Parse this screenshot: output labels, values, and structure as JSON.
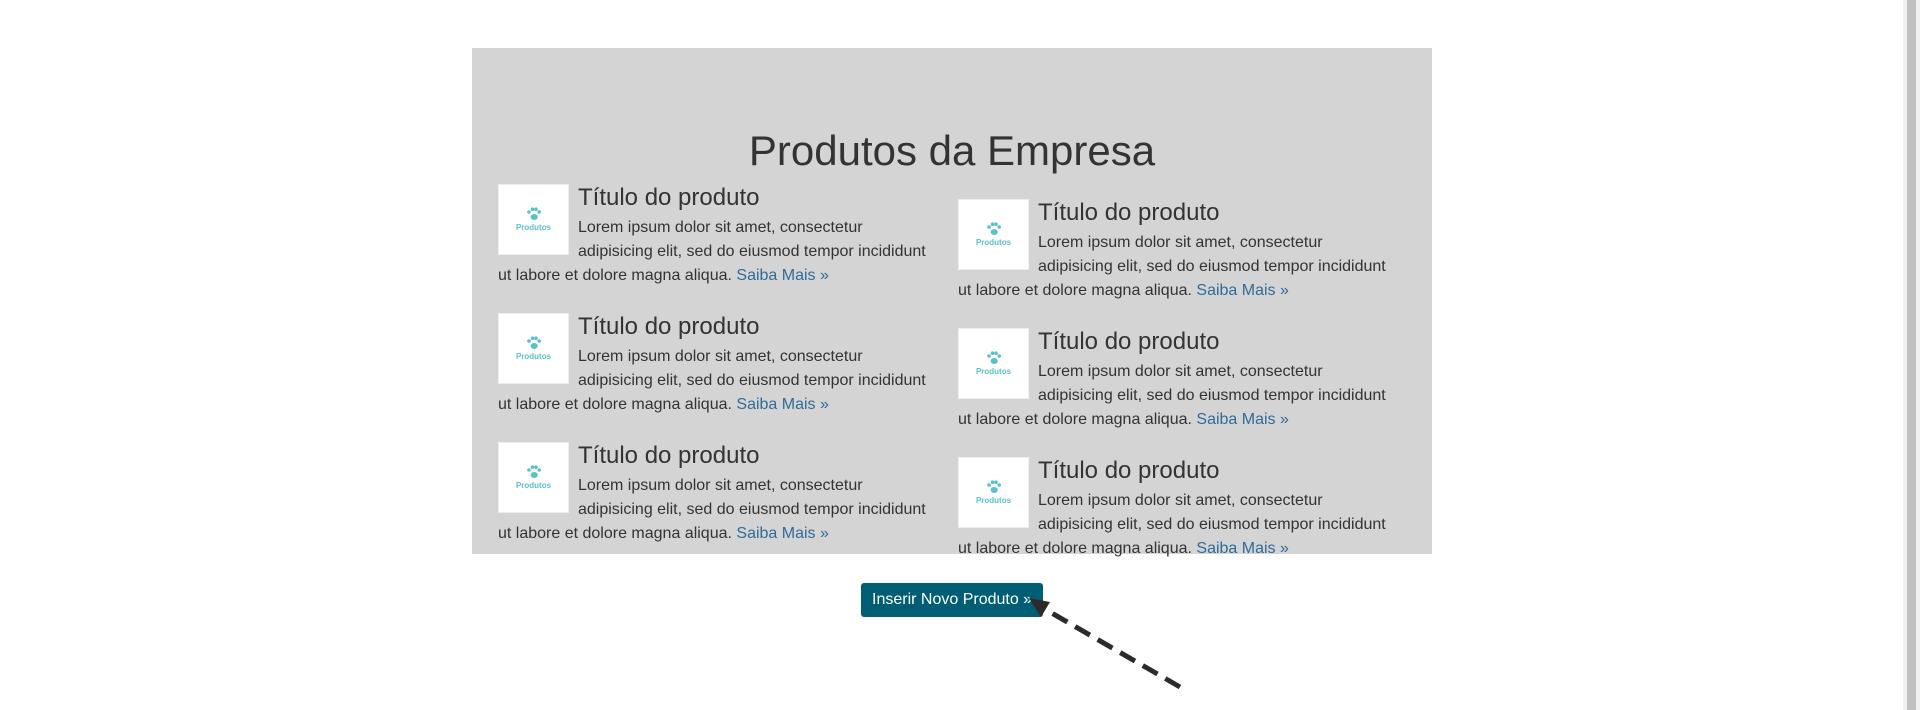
{
  "panel": {
    "title": "Produtos da Empresa"
  },
  "products_left": [
    {
      "title": "Título do produto",
      "description": "Lorem ipsum dolor sit amet, consectetur adipisicing elit, sed do eiusmod tempor incididunt ut labore et dolore magna aliqua.",
      "link": "Saiba Mais »",
      "thumb_text": "Produtos",
      "thumb_icon": "paw-icon"
    },
    {
      "title": "Título do produto",
      "description": "Lorem ipsum dolor sit amet, consectetur adipisicing elit, sed do eiusmod tempor incididunt ut labore et dolore magna aliqua.",
      "link": "Saiba Mais »",
      "thumb_text": "Produtos",
      "thumb_icon": "paw-icon"
    },
    {
      "title": "Título do produto",
      "description": "Lorem ipsum dolor sit amet, consectetur adipisicing elit, sed do eiusmod tempor incididunt ut labore et dolore magna aliqua.",
      "link": "Saiba Mais »",
      "thumb_text": "Produtos",
      "thumb_icon": "paw-icon"
    }
  ],
  "products_right": [
    {
      "title": "Título do produto",
      "description": "Lorem ipsum dolor sit amet, consectetur adipisicing elit, sed do eiusmod tempor incididunt ut labore et dolore magna aliqua.",
      "link": "Saiba Mais »",
      "thumb_text": "Produtos",
      "thumb_icon": "paw-icon"
    },
    {
      "title": "Título do produto",
      "description": "Lorem ipsum dolor sit amet, consectetur adipisicing elit, sed do eiusmod tempor incididunt ut labore et dolore magna aliqua.",
      "link": "Saiba Mais »",
      "thumb_text": "Produtos",
      "thumb_icon": "paw-icon"
    },
    {
      "title": "Título do produto",
      "description": "Lorem ipsum dolor sit amet, consectetur adipisicing elit, sed do eiusmod tempor incididunt ut labore et dolore magna aliqua.",
      "link": "Saiba Mais »",
      "thumb_text": "Produtos",
      "thumb_icon": "paw-icon"
    }
  ],
  "action": {
    "insert_label": "Inserir Novo Produto »"
  },
  "colors": {
    "panel_background": "#d4d4d4",
    "button_background": "#005e74",
    "link": "#2f6b9a",
    "logo_teal": "#5bc0c9"
  },
  "annotation": {
    "icon": "dashed-arrow-icon"
  }
}
